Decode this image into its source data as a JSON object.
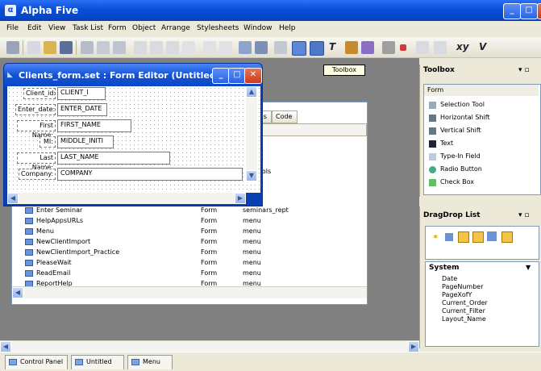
{
  "app": {
    "title": "Alpha Five",
    "icon": "alpha-logo"
  },
  "menu": [
    "File",
    "Edit",
    "View",
    "Task List",
    "Form",
    "Object",
    "Arrange",
    "Stylesheets",
    "Window",
    "Help"
  ],
  "toolbar": {
    "text_tools": [
      "T",
      "xy",
      "V"
    ]
  },
  "tooltip": "Toolbox",
  "form_editor": {
    "title": "Clients_form.set : Form Editor (Untitled)",
    "fields": [
      {
        "label": "Client_id:",
        "value": "CLIENT_I"
      },
      {
        "label": "Enter_date:",
        "value": "ENTER_DATE"
      },
      {
        "label": "First Name:",
        "value": "FIRST_NAME"
      },
      {
        "label": "MI:",
        "value": "MIDDLE_INITI"
      },
      {
        "label": "Last Name:",
        "value": "LAST_NAME"
      },
      {
        "label": "Company:",
        "value": "COMPANY"
      }
    ]
  },
  "object_list": {
    "tabs": [
      "...ns",
      "Code"
    ],
    "header_col3": "Set",
    "partial_rows": [
      "form",
      "form",
      "form",
      "...ontrols"
    ],
    "rows": [
      {
        "name": "Enter Seminar",
        "type": "Form",
        "set": "seminars_rept"
      },
      {
        "name": "HelpAppsURLs",
        "type": "Form",
        "set": "menu"
      },
      {
        "name": "Menu",
        "type": "Form",
        "set": "menu"
      },
      {
        "name": "NewClientImport",
        "type": "Form",
        "set": "menu"
      },
      {
        "name": "NewClientImport_Practice",
        "type": "Form",
        "set": "menu"
      },
      {
        "name": "PleaseWait",
        "type": "Form",
        "set": "menu"
      },
      {
        "name": "ReadEmail",
        "type": "Form",
        "set": "menu"
      },
      {
        "name": "ReportHelp",
        "type": "Form",
        "set": "menu"
      }
    ]
  },
  "toolbox": {
    "title": "Toolbox",
    "category": "Form",
    "tools": [
      "Selection Tool",
      "Horizontal Shift",
      "Vertical Shift",
      "Text",
      "Type-In Field",
      "Radio Button",
      "Check Box"
    ]
  },
  "dragdrop": {
    "title": "DragDrop List",
    "group": "System",
    "items": [
      "Date",
      "PageNumber",
      "PageXofY",
      "Current_Order",
      "Current_Filter",
      "Layout_Name"
    ]
  },
  "taskbar": [
    "Control Panel",
    "Untitled",
    "Menu"
  ],
  "colors": {
    "titlebar": "#0a4fd8",
    "accent": "#1553d6",
    "workspace": "#808080"
  }
}
